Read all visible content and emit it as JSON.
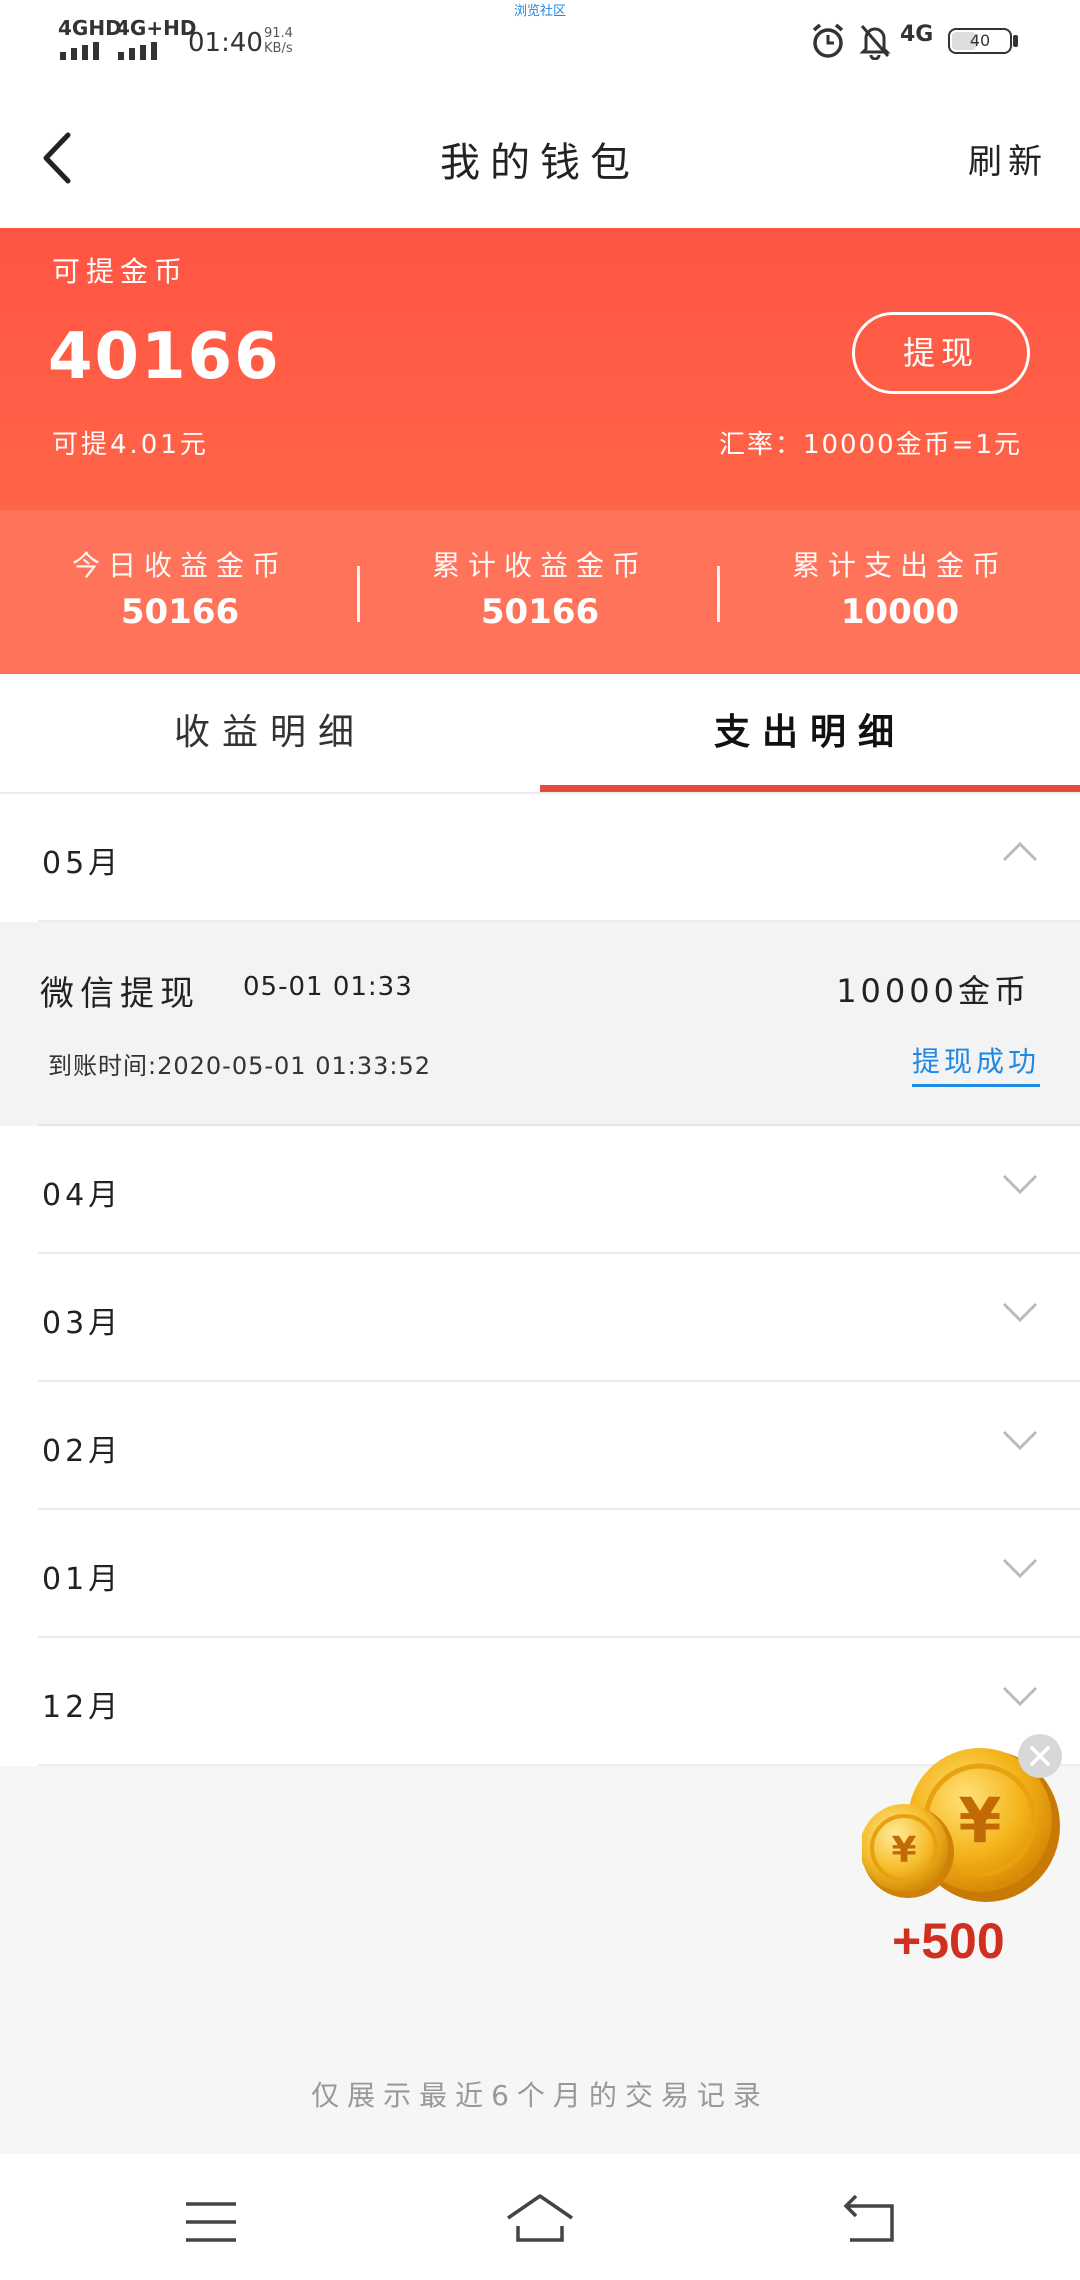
{
  "status_bar": {
    "network1": "4GHD",
    "network2": "4G+HD",
    "time": "01:40",
    "speed_value": "91.4",
    "speed_unit": "KB/s",
    "center_text": "浏览社区",
    "network3": "4G",
    "battery": "40"
  },
  "header": {
    "title": "我的钱包",
    "refresh_label": "刷新"
  },
  "balance": {
    "label": "可提金币",
    "value": "40166",
    "withdraw_label": "提现",
    "available": "可提4.01元",
    "rate": "汇率：10000金币=1元"
  },
  "stats": [
    {
      "label": "今日收益金币",
      "value": "50166"
    },
    {
      "label": "累计收益金币",
      "value": "50166"
    },
    {
      "label": "累计支出金币",
      "value": "10000"
    }
  ],
  "tabs": {
    "income": "收益明细",
    "expense": "支出明细",
    "active": "expense"
  },
  "months": [
    {
      "label": "05月",
      "expanded": true
    },
    {
      "label": "04月",
      "expanded": false
    },
    {
      "label": "03月",
      "expanded": false
    },
    {
      "label": "02月",
      "expanded": false
    },
    {
      "label": "01月",
      "expanded": false
    },
    {
      "label": "12月",
      "expanded": false
    }
  ],
  "record": {
    "title": "微信提现",
    "date": "05-01 01:33",
    "amount": "10000金币",
    "arrival_time": "到账时间:2020-05-01 01:33:52",
    "status": "提现成功"
  },
  "coin_reward": {
    "amount": "+500",
    "icon": "coin-icon"
  },
  "footnote": "仅展示最近6个月的交易记录",
  "nav": {
    "icons": [
      "menu-icon",
      "home-icon",
      "back-icon"
    ]
  },
  "colors": {
    "accent": "#e8493d",
    "card_top": "#ff5544",
    "stats_bg": "#ff735a",
    "link": "#1e88e5"
  }
}
